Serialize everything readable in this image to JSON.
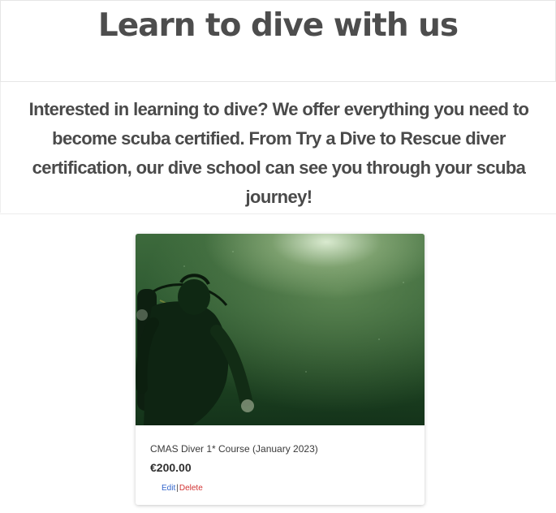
{
  "header": {
    "title": "Learn to dive with us"
  },
  "intro": {
    "text": "Interested in learning to dive? We offer everything you need to become scuba certified. From Try a Dive to Rescue diver certification, our dive school can see you through your scuba journey!"
  },
  "products": [
    {
      "title": "CMAS Diver 1* Course (January 2023)",
      "price": "€200.00",
      "edit_label": "Edit",
      "separator": "|",
      "delete_label": "Delete",
      "image_icon": "diver-underwater-photo"
    }
  ],
  "colors": {
    "heading": "#4d4d4d",
    "edit_link": "#3366cc",
    "delete_link": "#d23333"
  }
}
